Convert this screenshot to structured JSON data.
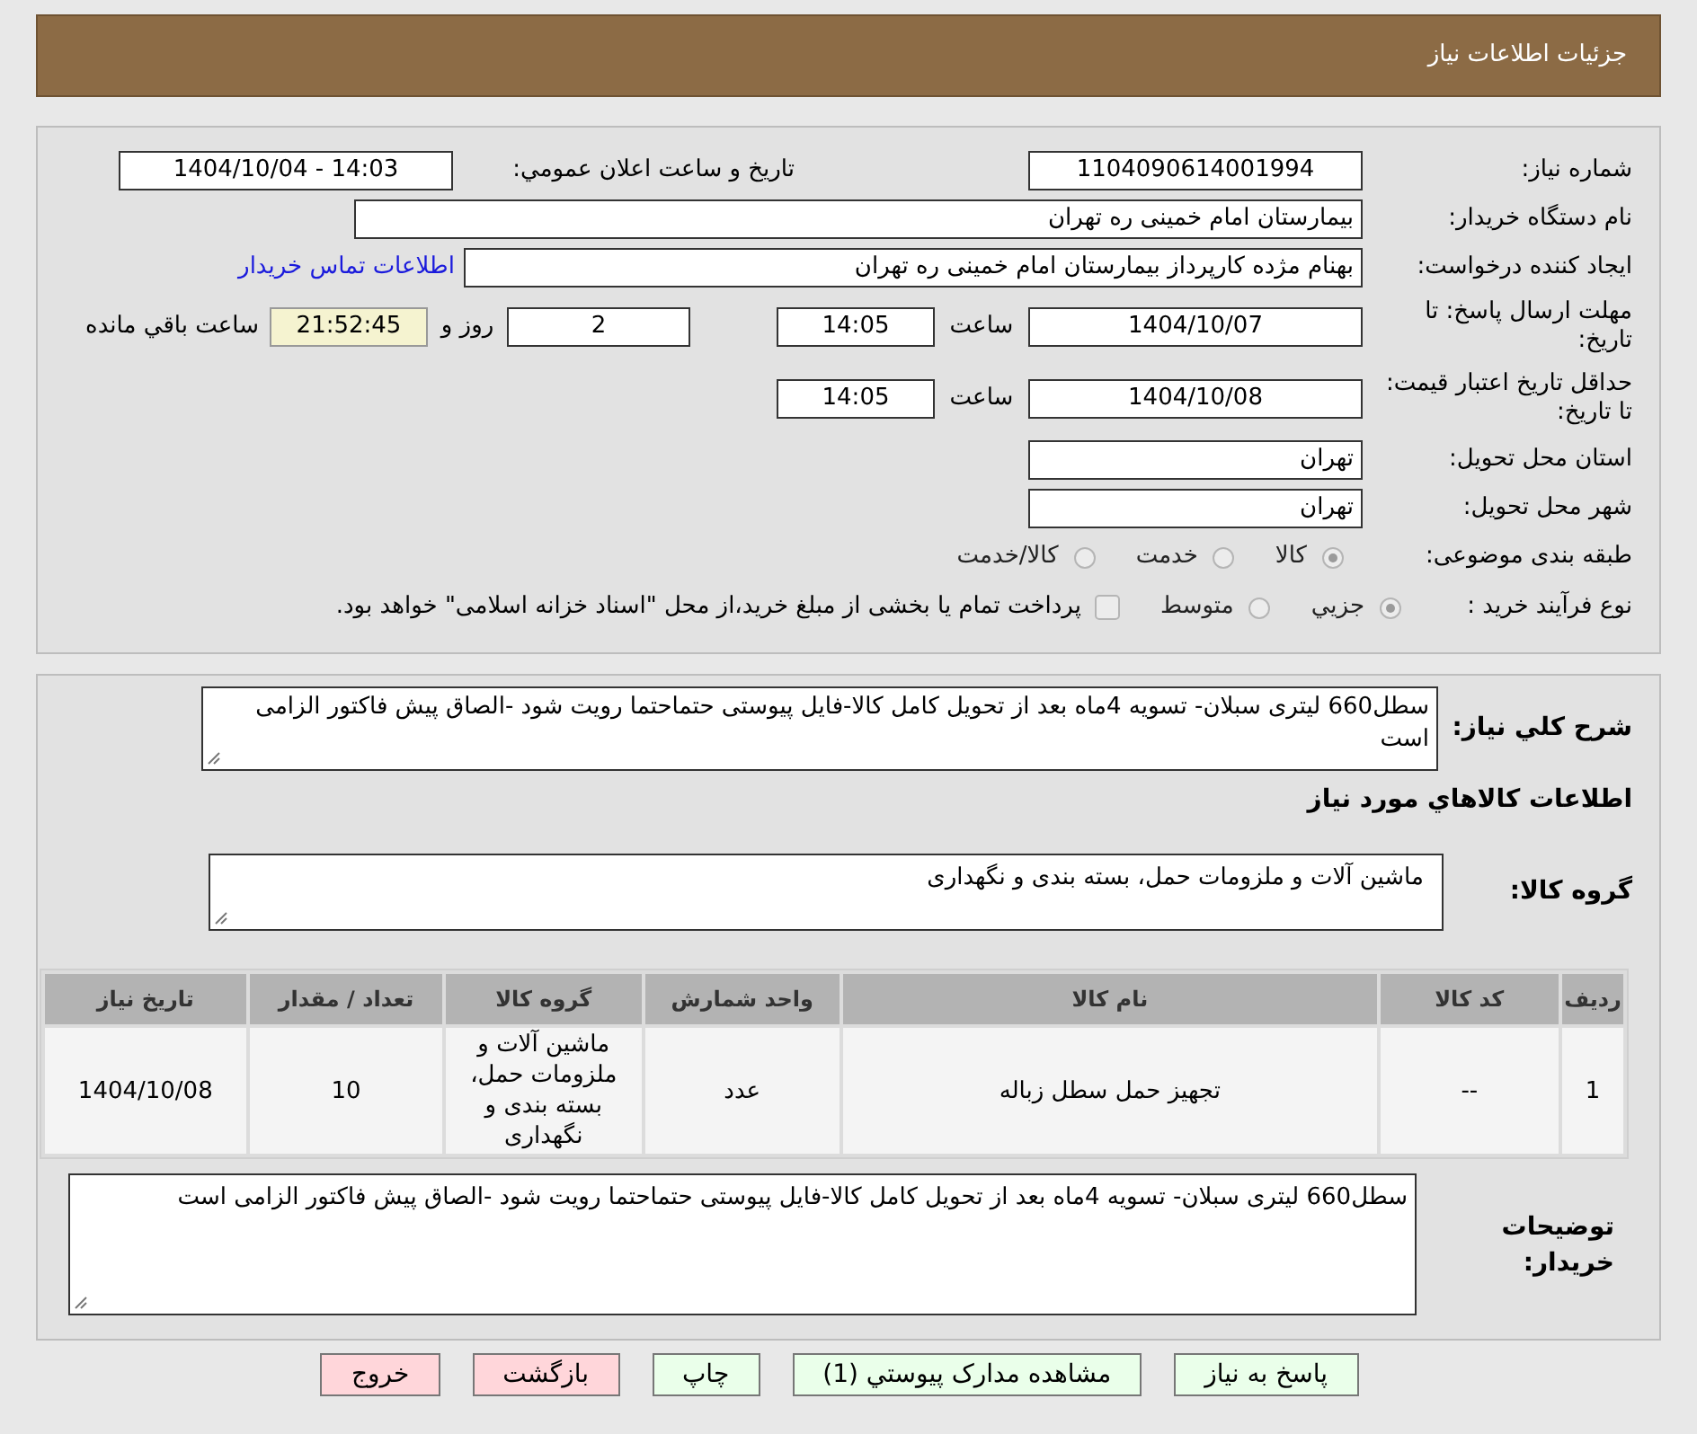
{
  "header": {
    "title": "جزئیات اطلاعات نیاز"
  },
  "need_number": {
    "label": "شماره نیاز:",
    "value": "1104090614001994"
  },
  "announce": {
    "label": "تاریخ و ساعت اعلان عمومي:",
    "value": "1404/10/04 - 14:03"
  },
  "buyer_org": {
    "label": "نام دستگاه خریدار:",
    "value": "بیمارستان امام خمینی ره  تهران"
  },
  "requester": {
    "label": "ایجاد کننده درخواست:",
    "value": "بهنام مژده کارپرداز بیمارستان امام خمینی ره  تهران",
    "link": "اطلاعات تماس خریدار"
  },
  "reply_deadline": {
    "label": "مهلت ارسال پاسخ: تا تاریخ:",
    "date": "1404/10/07",
    "time_label": "ساعت",
    "time": "14:05",
    "days": "2",
    "days_label": "روز و",
    "remaining": "21:52:45",
    "remaining_label": "ساعت باقي مانده"
  },
  "price_validity": {
    "label": "حداقل تاریخ اعتبار قیمت: تا تاریخ:",
    "date": "1404/10/08",
    "time_label": "ساعت",
    "time": "14:05"
  },
  "province": {
    "label": "استان محل تحویل:",
    "value": "تهران"
  },
  "city": {
    "label": "شهر محل تحویل:",
    "value": "تهران"
  },
  "category": {
    "label": "طبقه بندی موضوعی:",
    "options": [
      {
        "label": "کالا",
        "selected": true
      },
      {
        "label": "خدمت",
        "selected": false
      },
      {
        "label": "کالا/خدمت",
        "selected": false
      }
    ]
  },
  "process": {
    "label": "نوع فرآیند خرید :",
    "options": [
      {
        "label": "جزيي",
        "selected": true
      },
      {
        "label": "متوسط",
        "selected": false
      }
    ],
    "treasury": {
      "checked": false,
      "text": "پرداخت تمام یا بخشی از مبلغ خرید،از محل \"اسناد خزانه اسلامی\" خواهد بود."
    }
  },
  "summary": {
    "label": "شرح کلي نیاز:",
    "value": "سطل660 لیتری سبلان- تسویه 4ماه بعد از تحویل کامل کالا-فایل پیوستی حتماحتما رویت شود -الصاق پیش فاکتور الزامی است"
  },
  "goods_heading": "اطلاعات کالاهاي مورد نیاز",
  "goods_group": {
    "label": "گروه کالا:",
    "value": "ماشین آلات و ملزومات حمل، بسته بندی و نگهداری"
  },
  "table": {
    "columns": [
      "ردیف",
      "کد کالا",
      "نام کالا",
      "واحد شمارش",
      "گروه کالا",
      "تعداد / مقدار",
      "تاریخ نیاز"
    ],
    "rows": [
      [
        "1",
        "--",
        "تجهیز حمل سطل زباله",
        "عدد",
        "ماشین آلات و ملزومات حمل، بسته بندی و نگهداری",
        "10",
        "1404/10/08"
      ]
    ]
  },
  "buyer_notes": {
    "label": "توضیحات خریدار:",
    "value": "سطل660 لیتری سبلان- تسویه 4ماه بعد از تحویل کامل کالا-فایل پیوستی حتماحتما رویت شود -الصاق پیش فاکتور الزامی است"
  },
  "buttons": [
    {
      "label": "پاسخ به نیاز",
      "kind": "action"
    },
    {
      "label": "مشاهده مدارک پیوستي (1)",
      "kind": "action"
    },
    {
      "label": "چاپ",
      "kind": "action"
    },
    {
      "label": "بازگشت",
      "kind": "exit"
    },
    {
      "label": "خروج",
      "kind": "exit"
    }
  ]
}
